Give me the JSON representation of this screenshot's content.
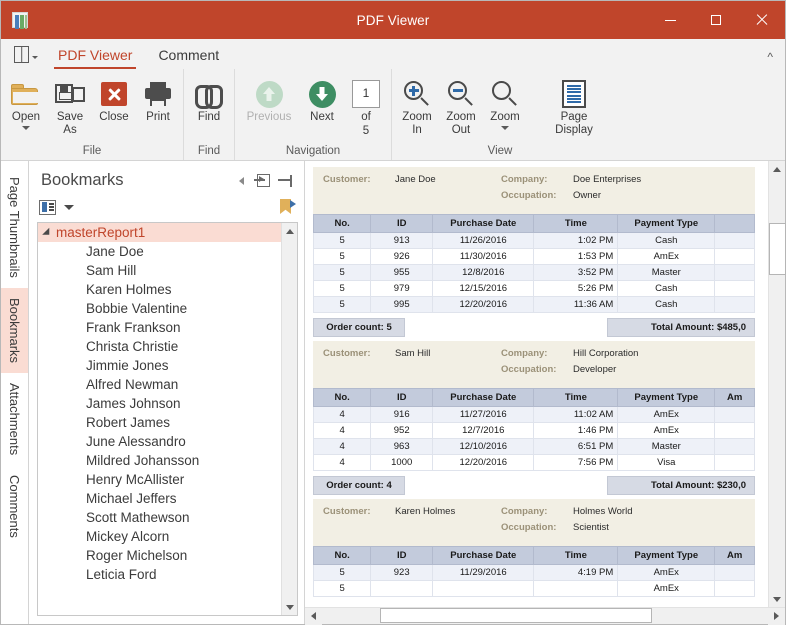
{
  "window": {
    "title": "PDF Viewer",
    "app_icon": "document-app-icon",
    "minimize": "minimize-icon",
    "maximize": "maximize-icon",
    "close": "close-icon",
    "accent_color": "#c0452b"
  },
  "ribbon": {
    "file_menu_icon": "book-menu-icon",
    "collapse_label": "^",
    "tabs": [
      {
        "label": "PDF Viewer",
        "active": true
      },
      {
        "label": "Comment",
        "active": false
      }
    ],
    "groups": [
      {
        "name": "File",
        "label": "File",
        "buttons": [
          {
            "label": "Open",
            "icon": "open-folder-icon",
            "dropdown": true,
            "disabled": false
          },
          {
            "label": "Save\nAs",
            "icon": "save-as-icon",
            "dropdown": false,
            "disabled": false
          },
          {
            "label": "Close",
            "icon": "close-document-icon",
            "dropdown": false,
            "disabled": false
          },
          {
            "label": "Print",
            "icon": "printer-icon",
            "dropdown": false,
            "disabled": false
          }
        ]
      },
      {
        "name": "Find",
        "label": "Find",
        "buttons": [
          {
            "label": "Find",
            "icon": "binoculars-icon",
            "dropdown": false,
            "disabled": false
          }
        ]
      },
      {
        "name": "Navigation",
        "label": "Navigation",
        "buttons": [
          {
            "label": "Previous",
            "icon": "arrow-up-circle-icon",
            "dropdown": false,
            "disabled": true
          },
          {
            "label": "Next",
            "icon": "arrow-down-circle-icon",
            "dropdown": false,
            "disabled": false
          }
        ],
        "page_number": "1",
        "page_of_label": "of",
        "page_total": "5"
      },
      {
        "name": "View",
        "label": "View",
        "buttons": [
          {
            "label": "Zoom\nIn",
            "icon": "zoom-in-icon",
            "dropdown": false,
            "disabled": false
          },
          {
            "label": "Zoom\nOut",
            "icon": "zoom-out-icon",
            "dropdown": false,
            "disabled": false
          },
          {
            "label": "Zoom",
            "icon": "zoom-icon",
            "dropdown": true,
            "disabled": false
          },
          {
            "label": "Page\nDisplay",
            "icon": "page-display-icon",
            "dropdown": true,
            "disabled": false
          }
        ]
      }
    ]
  },
  "side_rail": {
    "tabs": [
      {
        "label": "Page Thumbnails",
        "active": false
      },
      {
        "label": "Bookmarks",
        "active": true
      },
      {
        "label": "Attachments",
        "active": false
      },
      {
        "label": "Comments",
        "active": false
      }
    ]
  },
  "bookmarks_panel": {
    "title": "Bookmarks",
    "header_icons": [
      {
        "name": "collapse-left-icon"
      },
      {
        "name": "dock-panel-icon"
      },
      {
        "name": "pin-panel-icon"
      }
    ],
    "toolbar": {
      "list_options_icon": "bookmark-options-icon",
      "dropdown_icon": "chevron-down-icon",
      "new-bookmark_icon": "new-bookmark-icon"
    },
    "root": "masterReport1",
    "items": [
      "Jane Doe",
      "Sam Hill",
      "Karen Holmes",
      "Bobbie Valentine",
      "Frank Frankson",
      "Christa Christie",
      "Jimmie Jones",
      "Alfred Newman",
      "James Johnson",
      "Robert James",
      "June Alessandro",
      "Mildred Johansson",
      "Henry McAllister",
      "Michael Jeffers",
      "Scott Mathewson",
      "Mickey Alcorn",
      "Roger Michelson",
      "Leticia Ford"
    ]
  },
  "document": {
    "columns": [
      "No.",
      "ID",
      "Purchase Date",
      "Time",
      "Payment Type",
      "Am"
    ],
    "order_count_prefix": "Order count: ",
    "total_amount_prefix": "Total Amount: ",
    "labels": {
      "customer": "Customer:",
      "company": "Company:",
      "occupation": "Occupation:"
    },
    "reports": [
      {
        "customer": "Jane Doe",
        "company": "Doe Enterprises",
        "occupation": "Owner",
        "order_count": "5",
        "total_amount": "$485,0",
        "rows": [
          {
            "no": "5",
            "id": "913",
            "date": "11/26/2016",
            "time": "1:02 PM",
            "payment": "Cash",
            "amount": ""
          },
          {
            "no": "5",
            "id": "926",
            "date": "11/30/2016",
            "time": "1:53 PM",
            "payment": "AmEx",
            "amount": ""
          },
          {
            "no": "5",
            "id": "955",
            "date": "12/8/2016",
            "time": "3:52 PM",
            "payment": "Master",
            "amount": ""
          },
          {
            "no": "5",
            "id": "979",
            "date": "12/15/2016",
            "time": "5:26 PM",
            "payment": "Cash",
            "amount": ""
          },
          {
            "no": "5",
            "id": "995",
            "date": "12/20/2016",
            "time": "11:36 AM",
            "payment": "Cash",
            "amount": ""
          }
        ]
      },
      {
        "customer": "Sam Hill",
        "company": "Hill Corporation",
        "occupation": "Developer",
        "order_count": "4",
        "total_amount": "$230,0",
        "rows": [
          {
            "no": "4",
            "id": "916",
            "date": "11/27/2016",
            "time": "11:02 AM",
            "payment": "AmEx",
            "amount": ""
          },
          {
            "no": "4",
            "id": "952",
            "date": "12/7/2016",
            "time": "1:46 PM",
            "payment": "AmEx",
            "amount": ""
          },
          {
            "no": "4",
            "id": "963",
            "date": "12/10/2016",
            "time": "6:51 PM",
            "payment": "Master",
            "amount": ""
          },
          {
            "no": "4",
            "id": "1000",
            "date": "12/20/2016",
            "time": "7:56 PM",
            "payment": "Visa",
            "amount": ""
          }
        ]
      },
      {
        "customer": "Karen Holmes",
        "company": "Holmes World",
        "occupation": "Scientist",
        "order_count": "",
        "total_amount": "",
        "rows": [
          {
            "no": "5",
            "id": "923",
            "date": "11/29/2016",
            "time": "4:19 PM",
            "payment": "AmEx",
            "amount": ""
          },
          {
            "no": "5",
            "id": "",
            "date": "",
            "time": "",
            "payment": "AmEx",
            "amount": ""
          }
        ]
      }
    ]
  },
  "scrollbars": {
    "vertical_up": "scroll-up-icon",
    "vertical_down": "scroll-down-icon",
    "horizontal_left": "scroll-left-icon",
    "horizontal_right": "scroll-right-icon"
  }
}
